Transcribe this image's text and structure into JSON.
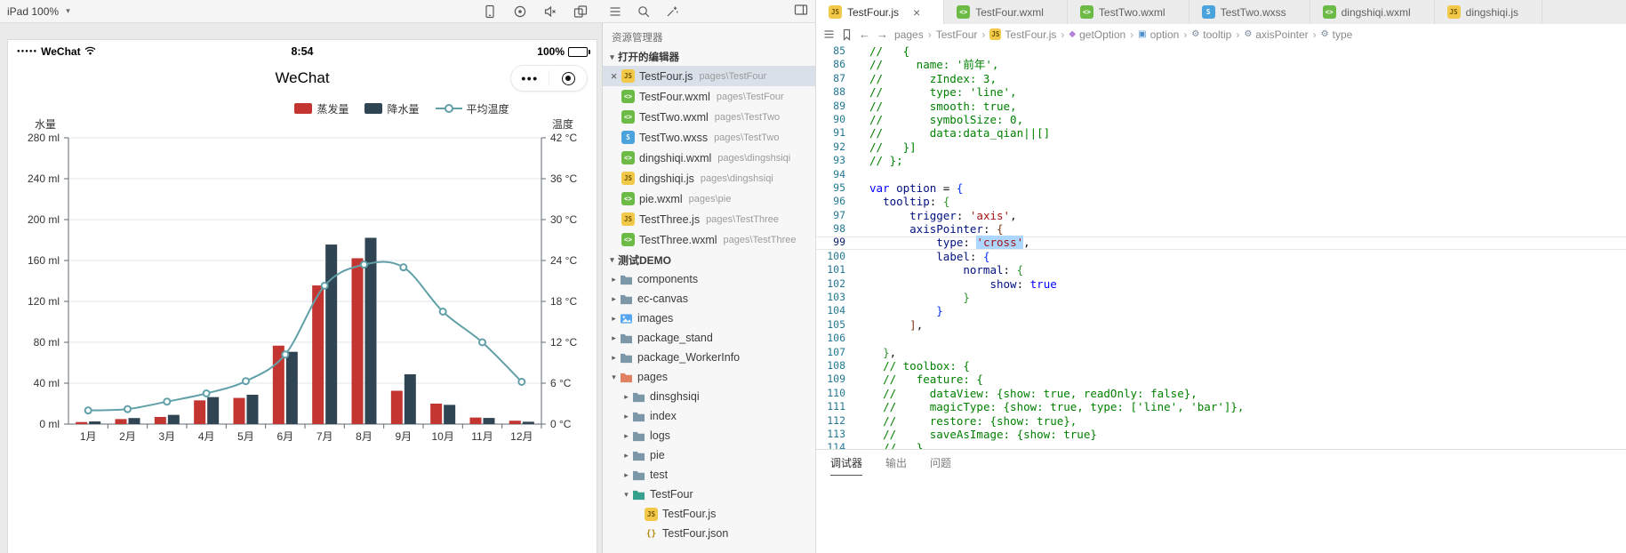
{
  "toolbar": {
    "device_selector": "iPad 100%"
  },
  "simulator": {
    "status_bar": {
      "carrier_dots": "●●●●●",
      "carrier": "WeChat",
      "time": "8:54",
      "battery_percent": "100%"
    },
    "nav_bar": {
      "title": "WeChat",
      "menu_dots": "•••"
    },
    "chart_data": {
      "type": "bar",
      "title": "",
      "categories": [
        "1月",
        "2月",
        "3月",
        "4月",
        "5月",
        "6月",
        "7月",
        "8月",
        "9月",
        "10月",
        "11月",
        "12月"
      ],
      "series": [
        {
          "name": "蒸发量",
          "type": "bar",
          "color": "#c23531",
          "axis": "left",
          "values": [
            2.0,
            4.9,
            7.0,
            23.2,
            25.6,
            76.7,
            135.6,
            162.2,
            32.6,
            20.0,
            6.4,
            3.3
          ]
        },
        {
          "name": "降水量",
          "type": "bar",
          "color": "#2f4554",
          "axis": "left",
          "values": [
            2.6,
            5.9,
            9.0,
            26.4,
            28.7,
            70.7,
            175.6,
            182.2,
            48.7,
            18.8,
            6.0,
            2.3
          ]
        },
        {
          "name": "平均温度",
          "type": "line",
          "color": "#61a0a8",
          "axis": "right",
          "values": [
            2.0,
            2.2,
            3.3,
            4.5,
            6.3,
            10.2,
            20.3,
            23.4,
            23.0,
            16.5,
            12.0,
            6.2
          ]
        }
      ],
      "y_left": {
        "name": "水量",
        "min": 0,
        "max": 280,
        "step": 40,
        "suffix": " ml"
      },
      "y_right": {
        "name": "温度",
        "min": 0,
        "max": 42,
        "step": 6,
        "suffix": " °C"
      },
      "xlabel": "",
      "ylabel": "水量 / 温度",
      "legend_position": "top",
      "grid": true
    }
  },
  "explorer": {
    "title": "资源管理器",
    "open_editors": {
      "label": "打开的编辑器",
      "items": [
        {
          "name": "TestFour.js",
          "path": "pages\\TestFour",
          "type": "js",
          "selected": true
        },
        {
          "name": "TestFour.wxml",
          "path": "pages\\TestFour",
          "type": "wxml"
        },
        {
          "name": "TestTwo.wxml",
          "path": "pages\\TestTwo",
          "type": "wxml"
        },
        {
          "name": "TestTwo.wxss",
          "path": "pages\\TestTwo",
          "type": "wxss"
        },
        {
          "name": "dingshiqi.wxml",
          "path": "pages\\dingshsiqi",
          "type": "wxml"
        },
        {
          "name": "dingshiqi.js",
          "path": "pages\\dingshsiqi",
          "type": "js"
        },
        {
          "name": "pie.wxml",
          "path": "pages\\pie",
          "type": "wxml"
        },
        {
          "name": "TestThree.js",
          "path": "pages\\TestThree",
          "type": "js"
        },
        {
          "name": "TestThree.wxml",
          "path": "pages\\TestThree",
          "type": "wxml"
        }
      ]
    },
    "tree": {
      "label": "测试DEMO",
      "items": [
        {
          "name": "components",
          "kind": "folder",
          "depth": 0
        },
        {
          "name": "ec-canvas",
          "kind": "folder",
          "depth": 0
        },
        {
          "name": "images",
          "kind": "folder-images",
          "depth": 0
        },
        {
          "name": "package_stand",
          "kind": "folder",
          "depth": 0
        },
        {
          "name": "package_WorkerInfo",
          "kind": "folder",
          "depth": 0
        },
        {
          "name": "pages",
          "kind": "folder-pages",
          "depth": 0,
          "expanded": true
        },
        {
          "name": "dinsghsiqi",
          "kind": "folder",
          "depth": 1
        },
        {
          "name": "index",
          "kind": "folder",
          "depth": 1
        },
        {
          "name": "logs",
          "kind": "folder",
          "depth": 1
        },
        {
          "name": "pie",
          "kind": "folder",
          "depth": 1
        },
        {
          "name": "test",
          "kind": "folder",
          "depth": 1
        },
        {
          "name": "TestFour",
          "kind": "folder-open",
          "depth": 1,
          "expanded": true
        },
        {
          "name": "TestFour.js",
          "kind": "file",
          "type": "js",
          "depth": 2
        },
        {
          "name": "TestFour.json",
          "kind": "file",
          "type": "json",
          "depth": 2
        }
      ]
    }
  },
  "editor": {
    "tabs": [
      {
        "name": "TestFour.js",
        "type": "js",
        "active": true
      },
      {
        "name": "TestFour.wxml",
        "type": "wxml"
      },
      {
        "name": "TestTwo.wxml",
        "type": "wxml"
      },
      {
        "name": "TestTwo.wxss",
        "type": "wxss"
      },
      {
        "name": "dingshiqi.wxml",
        "type": "wxml"
      },
      {
        "name": "dingshiqi.js",
        "type": "js"
      }
    ],
    "breadcrumbs": [
      {
        "label": "pages"
      },
      {
        "label": "TestFour"
      },
      {
        "label": "TestFour.js",
        "icon": "js"
      },
      {
        "label": "getOption",
        "icon": "method"
      },
      {
        "label": "option",
        "icon": "variable"
      },
      {
        "label": "tooltip",
        "icon": "property"
      },
      {
        "label": "axisPointer",
        "icon": "property"
      },
      {
        "label": "type",
        "icon": "property"
      }
    ],
    "code": {
      "lines": [
        {
          "n": 85,
          "tok": [
            [
              "cmt",
              "//   {"
            ]
          ]
        },
        {
          "n": 86,
          "tok": [
            [
              "cmt",
              "//     name: '前年',"
            ]
          ]
        },
        {
          "n": 87,
          "tok": [
            [
              "cmt",
              "//       zIndex: 3,"
            ]
          ]
        },
        {
          "n": 88,
          "tok": [
            [
              "cmt",
              "//       type: 'line',"
            ]
          ]
        },
        {
          "n": 89,
          "tok": [
            [
              "cmt",
              "//       smooth: true,"
            ]
          ]
        },
        {
          "n": 90,
          "tok": [
            [
              "cmt",
              "//       symbolSize: 0,"
            ]
          ]
        },
        {
          "n": 91,
          "tok": [
            [
              "cmt",
              "//       data:data_qian||[]"
            ]
          ]
        },
        {
          "n": 92,
          "tok": [
            [
              "cmt",
              "//   }]"
            ]
          ]
        },
        {
          "n": 93,
          "tok": [
            [
              "cmt",
              "// };"
            ]
          ]
        },
        {
          "n": 94,
          "tok": []
        },
        {
          "n": 95,
          "tok": [
            [
              "kw",
              "var"
            ],
            [
              "pln",
              " "
            ],
            [
              "vr",
              "option"
            ],
            [
              "pln",
              " = "
            ],
            [
              "b1",
              "{"
            ]
          ]
        },
        {
          "n": 96,
          "tok": [
            [
              "pln",
              "  "
            ],
            [
              "pr",
              "tooltip"
            ],
            [
              "pln",
              ": "
            ],
            [
              "b2",
              "{"
            ]
          ]
        },
        {
          "n": 97,
          "tok": [
            [
              "pln",
              "      "
            ],
            [
              "pr",
              "trigger"
            ],
            [
              "pln",
              ": "
            ],
            [
              "str",
              "'axis'"
            ],
            [
              "pln",
              ","
            ]
          ]
        },
        {
          "n": 98,
          "tok": [
            [
              "pln",
              "      "
            ],
            [
              "pr",
              "axisPointer"
            ],
            [
              "pln",
              ": "
            ],
            [
              "b3",
              "{"
            ]
          ]
        },
        {
          "n": 99,
          "current": true,
          "tok": [
            [
              "pln",
              "          "
            ],
            [
              "pr",
              "type"
            ],
            [
              "pln",
              ": "
            ],
            [
              "strsel",
              "'cross'"
            ],
            [
              "pln",
              ","
            ]
          ]
        },
        {
          "n": 100,
          "tok": [
            [
              "pln",
              "          "
            ],
            [
              "pr",
              "label"
            ],
            [
              "pln",
              ": "
            ],
            [
              "b1",
              "{"
            ]
          ]
        },
        {
          "n": 101,
          "tok": [
            [
              "pln",
              "              "
            ],
            [
              "pr",
              "normal"
            ],
            [
              "pln",
              ": "
            ],
            [
              "b2",
              "{"
            ]
          ]
        },
        {
          "n": 102,
          "tok": [
            [
              "pln",
              "                  "
            ],
            [
              "pr",
              "show"
            ],
            [
              "pln",
              ": "
            ],
            [
              "kw",
              "true"
            ]
          ]
        },
        {
          "n": 103,
          "tok": [
            [
              "pln",
              "              "
            ],
            [
              "b2",
              "}"
            ]
          ]
        },
        {
          "n": 104,
          "tok": [
            [
              "pln",
              "          "
            ],
            [
              "b1",
              "}"
            ]
          ]
        },
        {
          "n": 105,
          "tok": [
            [
              "pln",
              "      "
            ],
            [
              "b3",
              "]"
            ],
            [
              "pln",
              ","
            ]
          ]
        },
        {
          "n": 106,
          "tok": []
        },
        {
          "n": 107,
          "tok": [
            [
              "pln",
              "  "
            ],
            [
              "b2",
              "}"
            ],
            [
              "pln",
              ","
            ]
          ]
        },
        {
          "n": 108,
          "tok": [
            [
              "pln",
              "  "
            ],
            [
              "cmt",
              "// toolbox: {"
            ]
          ]
        },
        {
          "n": 109,
          "tok": [
            [
              "pln",
              "  "
            ],
            [
              "cmt",
              "//   feature: {"
            ]
          ]
        },
        {
          "n": 110,
          "tok": [
            [
              "pln",
              "  "
            ],
            [
              "cmt",
              "//     dataView: {show: true, readOnly: false},"
            ]
          ]
        },
        {
          "n": 111,
          "tok": [
            [
              "pln",
              "  "
            ],
            [
              "cmt",
              "//     magicType: {show: true, type: ['line', 'bar']},"
            ]
          ]
        },
        {
          "n": 112,
          "tok": [
            [
              "pln",
              "  "
            ],
            [
              "cmt",
              "//     restore: {show: true},"
            ]
          ]
        },
        {
          "n": 113,
          "tok": [
            [
              "pln",
              "  "
            ],
            [
              "cmt",
              "//     saveAsImage: {show: true}"
            ]
          ]
        },
        {
          "n": 114,
          "tok": [
            [
              "pln",
              "  "
            ],
            [
              "cmt",
              "//   }"
            ]
          ]
        }
      ]
    },
    "panel_tabs": [
      {
        "label": "调试器",
        "active": true
      },
      {
        "label": "输出"
      },
      {
        "label": "问题"
      }
    ]
  }
}
